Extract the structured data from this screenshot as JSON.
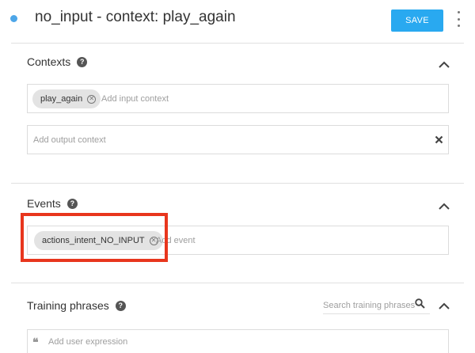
{
  "header": {
    "title": "no_input - context: play_again",
    "save_label": "SAVE",
    "status_dot_color": "#4da6e8",
    "accent": "#29a9f0"
  },
  "contexts": {
    "title": "Contexts",
    "input_chips": [
      "play_again"
    ],
    "input_placeholder": "Add input context",
    "output_placeholder": "Add output context"
  },
  "events": {
    "title": "Events",
    "chips": [
      "actions_intent_NO_INPUT"
    ],
    "placeholder": "Add event",
    "highlight_color": "#e8361d"
  },
  "training": {
    "title": "Training phrases",
    "search_placeholder": "Search training phrases",
    "expression_placeholder": "Add user expression"
  },
  "icons": [
    "status-dot",
    "help-icon",
    "chevron-up-icon",
    "chip-remove-icon",
    "clear-icon",
    "search-icon",
    "quote-icon",
    "more-vert-icon"
  ]
}
